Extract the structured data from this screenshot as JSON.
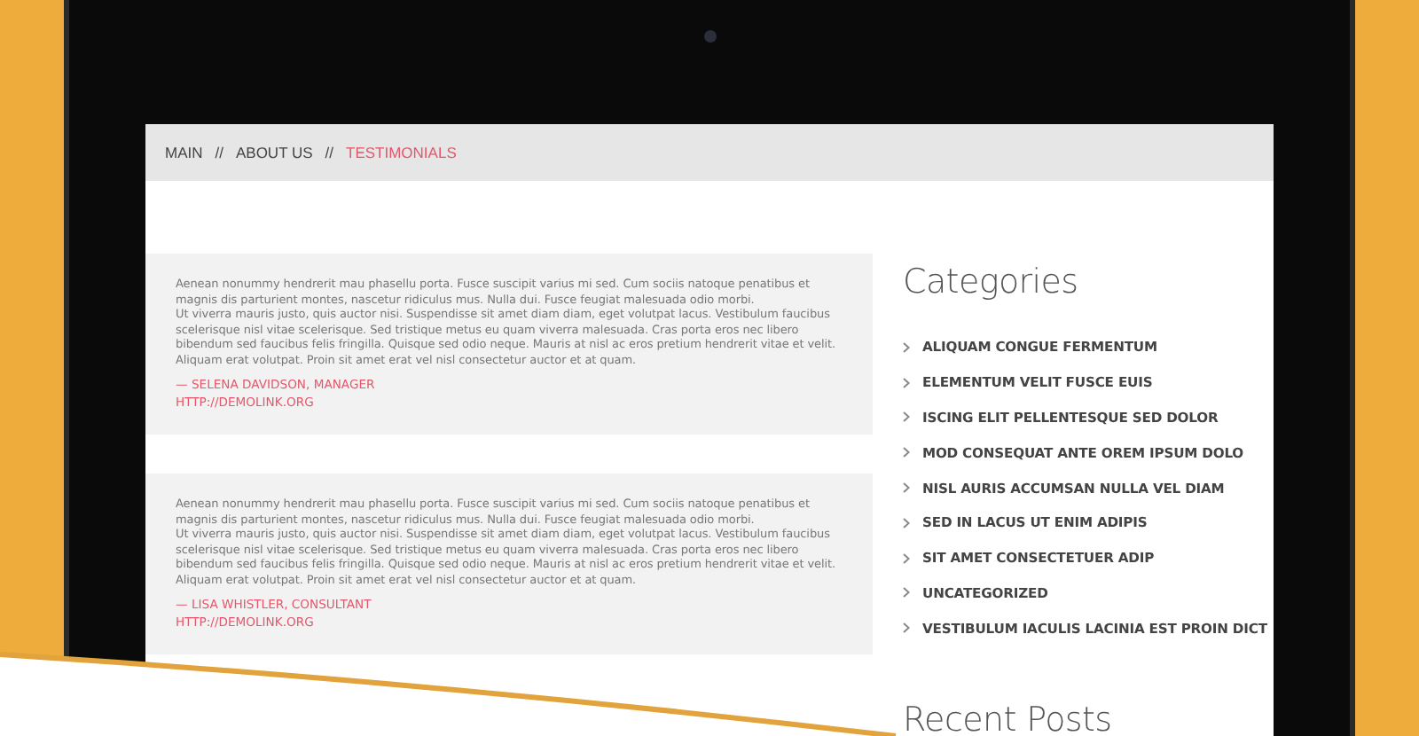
{
  "breadcrumb": [
    {
      "label": "MAIN",
      "current": false
    },
    {
      "label": "ABOUT US",
      "current": false
    },
    {
      "label": "TESTIMONIALS",
      "current": true
    }
  ],
  "breadcrumb_separator": "//",
  "testimonials": [
    {
      "paragraphs": [
        "Aenean nonummy hendrerit mau phasellu porta. Fusce suscipit varius mi sed. Cum sociis natoque penatibus et magnis dis parturient montes, nascetur ridiculus mus. Nulla dui. Fusce feugiat malesuada odio morbi.",
        "Ut viverra mauris justo, quis auctor nisi. Suspendisse sit amet diam diam, eget volutpat lacus. Vestibulum faucibus scelerisque nisl vitae scelerisque. Sed tristique metus eu quam viverra malesuada. Cras porta eros nec libero bibendum sed faucibus felis fringilla. Quisque sed odio neque. Mauris at nisl ac eros pretium hendrerit vitae et velit. Aliquam erat volutpat. Proin sit amet erat vel nisl consectetur auctor et at quam."
      ],
      "author": "— SELENA DAVIDSON, MANAGER",
      "link": "HTTP://DEMOLINK.ORG"
    },
    {
      "paragraphs": [
        "Aenean nonummy hendrerit mau phasellu porta. Fusce suscipit varius mi sed. Cum sociis natoque penatibus et magnis dis parturient montes, nascetur ridiculus mus. Nulla dui. Fusce feugiat malesuada odio morbi.",
        "Ut viverra mauris justo, quis auctor nisi. Suspendisse sit amet diam diam, eget volutpat lacus. Vestibulum faucibus scelerisque nisl vitae scelerisque. Sed tristique metus eu quam viverra malesuada. Cras porta eros nec libero bibendum sed faucibus felis fringilla. Quisque sed odio neque. Mauris at nisl ac eros pretium hendrerit vitae et velit. Aliquam erat volutpat. Proin sit amet erat vel nisl consectetur auctor et at quam."
      ],
      "author": "— LISA WHISTLER, CONSULTANT",
      "link": "HTTP://DEMOLINK.ORG"
    }
  ],
  "sidebar": {
    "categories_title": "Categories",
    "categories": [
      "ALIQUAM CONGUE FERMENTUM",
      "ELEMENTUM VELIT FUSCE EUIS",
      "ISCING ELIT PELLENTESQUE SED DOLOR",
      "MOD CONSEQUAT ANTE OREM IPSUM DOLO",
      "NISL AURIS ACCUMSAN NULLA VEL DIAM",
      "SED IN LACUS UT ENIM ADIPIS",
      "SIT AMET CONSECTETUER ADIP",
      "UNCATEGORIZED",
      "VESTIBULUM IACULIS LACINIA EST PROIN DICT"
    ],
    "recent_title": "Recent Posts"
  }
}
